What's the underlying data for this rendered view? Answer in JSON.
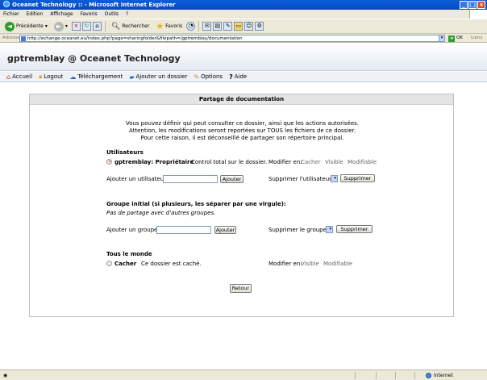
{
  "window": {
    "title": "Oceanet Technology :: - Microsoft Internet Explorer"
  },
  "menu": [
    "Fichier",
    "Edition",
    "Affichage",
    "Favoris",
    "Outils",
    "?"
  ],
  "toolbar": {
    "back_label": "Précédente",
    "search_label": "Rechercher",
    "favorites_label": "Favoris"
  },
  "address": {
    "label": "Adresse",
    "url": "http://echange.oceanet.eu/index.php?page=sharingfolder&filepath=/gptremblay/documentation",
    "go_label": "OK",
    "links_label": "Liens"
  },
  "header": {
    "title": "gptremblay @ Oceanet Technology"
  },
  "nav": [
    {
      "label": "Accueil",
      "icon": "home-icon"
    },
    {
      "label": "Logout",
      "icon": "lock-icon"
    },
    {
      "label": "Téléchargement",
      "icon": "upload-icon"
    },
    {
      "label": "Ajouter un dossier",
      "icon": "folder-add-icon"
    },
    {
      "label": "Options",
      "icon": "options-icon"
    },
    {
      "label": "Aide",
      "icon": "help-icon"
    }
  ],
  "panel": {
    "title": "Partage de documentation",
    "intro": [
      "Vous pouvez définir qui peut consulter ce dossier, ainsi que les actions autorisées.",
      "Attention, les modifications seront reportées sur TOUS les fichiers de ce dossier.",
      "Pour cette raison, il est déconseillé de partager son répertoire principal."
    ],
    "users": {
      "heading": "Utilisateurs",
      "owner_name": "gptremblay: Propriétaire",
      "owner_desc": "Control total sur le dossier.",
      "modify_label": "Modifier en:",
      "modes": [
        "Cacher",
        "Visible",
        "Modifiable"
      ],
      "add_label": "Ajouter un utilisateur:",
      "add_button": "Ajouter",
      "remove_label": "Supprimer l'utilisateur:",
      "remove_button": "Supprimer"
    },
    "groups": {
      "heading": "Groupe initial (si plusieurs, les séparer par une virgule):",
      "empty_text": "Pas de partage avec d'autres groupes.",
      "add_label": "Ajouter un groupe:",
      "add_button": "Ajouter",
      "remove_label": "Supprimer le groupe:",
      "remove_button": "Supprimer"
    },
    "world": {
      "heading": "Tous le monde",
      "option_label": "Cacher",
      "option_desc": "Ce dossier est caché.",
      "modify_label": "Modifier en:",
      "modes": [
        "Visible",
        "Modifiable"
      ]
    },
    "back_button": "Retour"
  },
  "status": {
    "zone": "Internet"
  }
}
